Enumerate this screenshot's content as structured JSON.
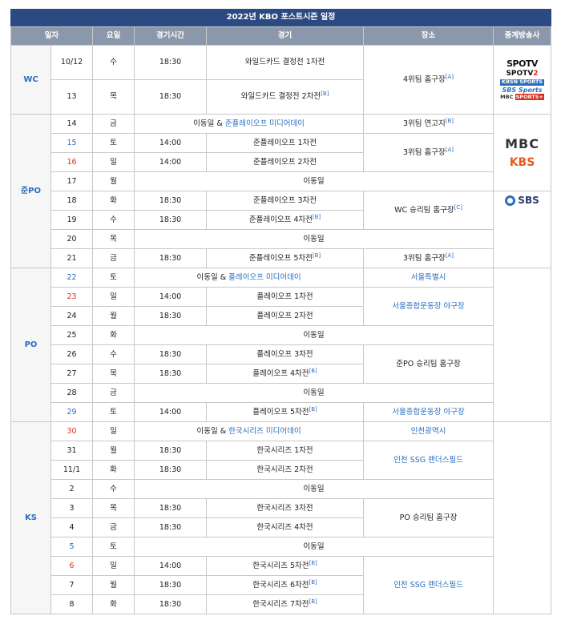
{
  "caption": "2022년 KBO 포스트시즌 일정",
  "headers": [
    "일자",
    "요일",
    "경기시간",
    "경기",
    "장소",
    "중계방송사"
  ],
  "phases": [
    "WC",
    "준PO",
    "PO",
    "KS"
  ],
  "travel_day": "이동일",
  "media_day_prefix": "이동일 & ",
  "games": {
    "wc1": "와일드카드 결정전 1차전",
    "wc2": "와일드카드 결정전 2차전",
    "ps_media": "준플레이오프 미디어데이",
    "ps1": "준플레이오프 1차전",
    "ps2": "준플레이오프 2차전",
    "ps3": "준플레이오프 3차전",
    "ps4": "준플레이오프 4차전",
    "ps5": "준플레이오프 5차전",
    "po_media": "플레이오프 미디어데이",
    "po1": "플레이오프 1차전",
    "po2": "플레이오프 2차전",
    "po3": "플레이오프 3차전",
    "po4": "플레이오프 4차전",
    "po5": "플레이오프 5차전",
    "ks_media": "한국시리즈 미디어데이",
    "ks1": "한국시리즈 1차전",
    "ks2": "한국시리즈 2차전",
    "ks3": "한국시리즈 3차전",
    "ks4": "한국시리즈 4차전",
    "ks5": "한국시리즈 5차전",
    "ks6": "한국시리즈 6차전",
    "ks7": "한국시리즈 7차전"
  },
  "notes": {
    "A": "[A]",
    "B": "[B]",
    "C": "[C]"
  },
  "venues": {
    "v4th": "4위팀 홈구장",
    "v3rd_base": "3위팀 연고지",
    "v3rd": "3위팀 홈구장",
    "wc_winner": "WC 승리팀 홈구장",
    "seoul": "서울특별시",
    "jamsil": "서울종합운동장 야구장",
    "ps_winner": "준PO 승리팀 홈구장",
    "incheon": "인천광역시",
    "ssg": "인천 SSG 랜더스필드",
    "po_winner": "PO 승리팀 홈구장"
  },
  "broadcasters": {
    "spotv": "SPOTV",
    "spotv2_a": "SPOTV",
    "spotv2_b": "2",
    "kbsn": "KBSN SPORTS",
    "sbs_sports": "SBS Sports",
    "mbc_sports_a": "MBC",
    "mbc_sports_b": "SPORTS+",
    "mbc": "MBC",
    "kbs": "KBS",
    "sbs": "SBS"
  },
  "rows": {
    "r1": {
      "date": "10/12",
      "dow": "수",
      "time": "18:30"
    },
    "r2": {
      "date": "13",
      "dow": "목",
      "time": "18:30"
    },
    "r3": {
      "date": "14",
      "dow": "금"
    },
    "r4": {
      "date": "15",
      "dow": "토",
      "time": "14:00"
    },
    "r5": {
      "date": "16",
      "dow": "일",
      "time": "14:00"
    },
    "r6": {
      "date": "17",
      "dow": "월"
    },
    "r7": {
      "date": "18",
      "dow": "화",
      "time": "18:30"
    },
    "r8": {
      "date": "19",
      "dow": "수",
      "time": "18:30"
    },
    "r9": {
      "date": "20",
      "dow": "목"
    },
    "r10": {
      "date": "21",
      "dow": "금",
      "time": "18:30"
    },
    "r11": {
      "date": "22",
      "dow": "토"
    },
    "r12": {
      "date": "23",
      "dow": "일",
      "time": "14:00"
    },
    "r13": {
      "date": "24",
      "dow": "월",
      "time": "18:30"
    },
    "r14": {
      "date": "25",
      "dow": "화"
    },
    "r15": {
      "date": "26",
      "dow": "수",
      "time": "18:30"
    },
    "r16": {
      "date": "27",
      "dow": "목",
      "time": "18:30"
    },
    "r17": {
      "date": "28",
      "dow": "금"
    },
    "r18": {
      "date": "29",
      "dow": "토",
      "time": "14:00"
    },
    "r19": {
      "date": "30",
      "dow": "일"
    },
    "r20": {
      "date": "31",
      "dow": "월",
      "time": "18:30"
    },
    "r21": {
      "date": "11/1",
      "dow": "화",
      "time": "18:30"
    },
    "r22": {
      "date": "2",
      "dow": "수"
    },
    "r23": {
      "date": "3",
      "dow": "목",
      "time": "18:30"
    },
    "r24": {
      "date": "4",
      "dow": "금",
      "time": "18:30"
    },
    "r25": {
      "date": "5",
      "dow": "토"
    },
    "r26": {
      "date": "6",
      "dow": "일",
      "time": "14:00"
    },
    "r27": {
      "date": "7",
      "dow": "월",
      "time": "18:30"
    },
    "r28": {
      "date": "8",
      "dow": "화",
      "time": "18:30"
    }
  },
  "colors": {
    "caption_bg": "#2c4a82",
    "header_bg": "#8b97ab",
    "link": "#2a6ebf",
    "holiday": "#d9301d"
  }
}
